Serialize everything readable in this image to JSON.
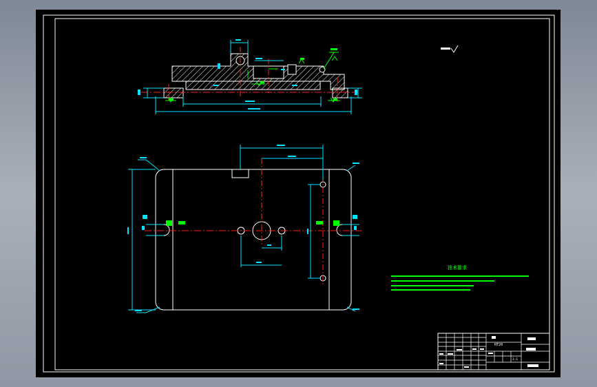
{
  "colors": {
    "background": "#000000",
    "frame": "#ffffff",
    "part": "#ffffff",
    "hatch": "#ffffff",
    "dimension": "#00e5ff",
    "centerline": "#ff2020",
    "annotation": "#00ff00",
    "viewport": "#9aa2ae"
  },
  "title_block": {
    "material_code": "HT20",
    "scale_code": "1:1"
  },
  "technical_requirements": {
    "heading": "技术要求"
  }
}
